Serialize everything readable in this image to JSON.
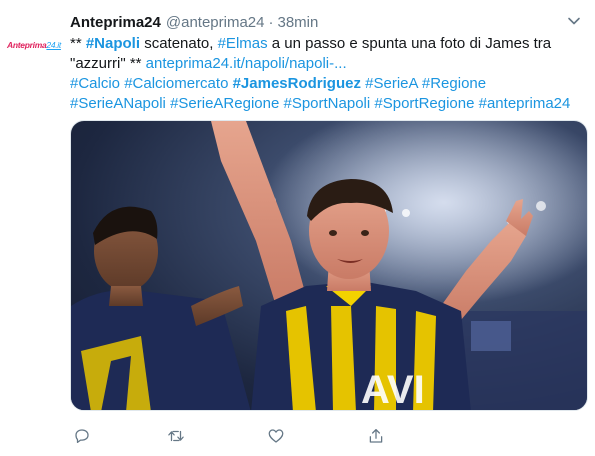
{
  "tweet": {
    "author_name": "Anteprima24",
    "handle": "@anteprima24",
    "separator": "·",
    "time": "38min",
    "avatar": {
      "logo_part1": "Anteprima",
      "logo_part2": "24.it"
    },
    "text": {
      "prefix": "** ",
      "hashtag_napoli": "#Napoli",
      "t1": " scatenato, ",
      "hashtag_elmas": "#Elmas",
      "t2": " a un passo e spunta una foto di James tra \"azzurri\" ** ",
      "link": "anteprima24.it/napoli/napoli-...",
      "hashtags": [
        "#Calcio",
        "#Calciomercato",
        "#JamesRodriguez",
        "#SerieA",
        "#Regione",
        "#SerieANapoli",
        "#SerieARegione",
        "#SportNapoli",
        "#SportRegione",
        "#anteprima24"
      ]
    },
    "media": {
      "jersey_text": "AVI"
    },
    "actions": {
      "reply_icon": "reply-icon",
      "retweet_icon": "retweet-icon",
      "like_icon": "heart-icon",
      "share_icon": "share-icon"
    },
    "colors": {
      "link": "#1b95e0",
      "secondary": "#657786",
      "logo_red": "#e0245e"
    }
  }
}
